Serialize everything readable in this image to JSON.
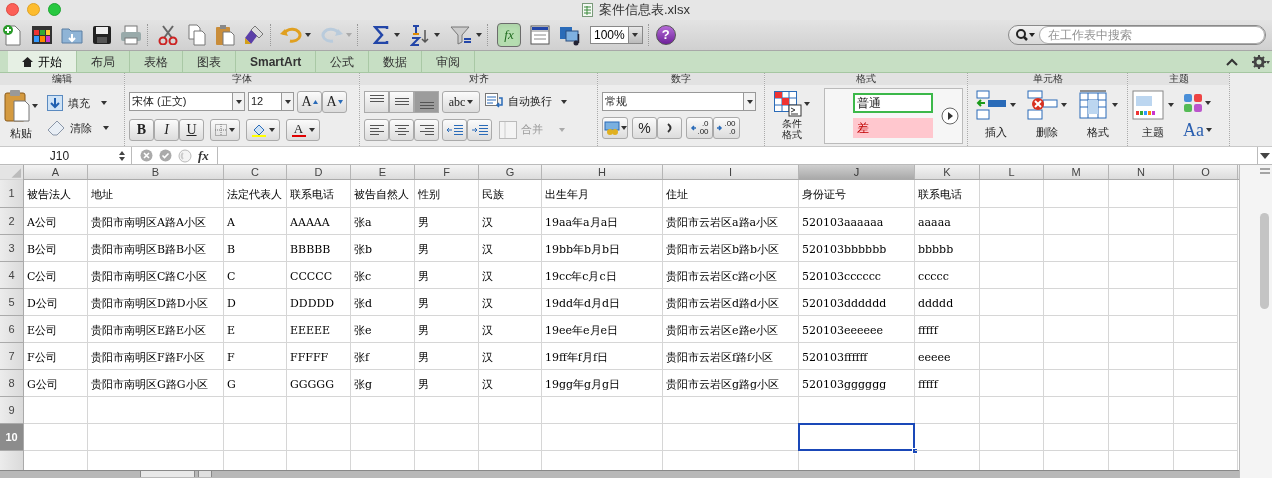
{
  "window": {
    "title": "案件信息表.xlsx"
  },
  "toolbar": {
    "zoom": "100%",
    "formula_builder": {
      "label": "fx",
      "selected": true
    },
    "help": "?",
    "search": {
      "placeholder": "在工作表中搜索"
    }
  },
  "tabs": [
    {
      "label": "开始",
      "selected": true
    },
    {
      "label": "布局",
      "selected": false
    },
    {
      "label": "表格",
      "selected": false
    },
    {
      "label": "图表",
      "selected": false
    },
    {
      "label": "SmartArt",
      "selected": false
    },
    {
      "label": "公式",
      "selected": false
    },
    {
      "label": "数据",
      "selected": false
    },
    {
      "label": "审阅",
      "selected": false
    }
  ],
  "ribbon": {
    "edit": {
      "title": "编辑",
      "paste": "粘贴",
      "fill": "填充",
      "clear": "清除"
    },
    "font": {
      "title": "字体",
      "name": "宋体 (正文)",
      "size": "12",
      "grow": "A",
      "shrink": "A",
      "bold": "B",
      "italic": "I",
      "underline": "U",
      "font_color": "A"
    },
    "align": {
      "title": "对齐",
      "vertical_align": [
        {
          "selected": false
        },
        {
          "selected": false
        },
        {
          "selected": true
        }
      ],
      "orientation": "abc",
      "wrap": "自动换行",
      "merge": "合并",
      "merge_disabled": true
    },
    "number": {
      "title": "数字",
      "format": "常规",
      "percent": "%",
      "decimals": [
        {
          "top": ".0",
          "bottom": ".00"
        },
        {
          "top": ".00",
          "bottom": ".0"
        }
      ]
    },
    "format": {
      "title": "格式",
      "conditional": "条件格式",
      "styles": [
        {
          "label": "普通",
          "kind": "normal"
        },
        {
          "label": "差",
          "kind": "bad"
        }
      ]
    },
    "cells": {
      "title": "单元格",
      "insert": "插入",
      "delete": "删除",
      "format": "格式"
    },
    "themes": {
      "title": "主题",
      "themes": "主题",
      "fonts": "Aa"
    }
  },
  "formula_bar": {
    "name_box": "J10",
    "fx": "fx"
  },
  "sheet": {
    "columns": [
      {
        "label": "A",
        "selected": false
      },
      {
        "label": "B",
        "selected": false
      },
      {
        "label": "C",
        "selected": false
      },
      {
        "label": "D",
        "selected": false
      },
      {
        "label": "E",
        "selected": false
      },
      {
        "label": "F",
        "selected": false
      },
      {
        "label": "G",
        "selected": false
      },
      {
        "label": "H",
        "selected": false
      },
      {
        "label": "I",
        "selected": false
      },
      {
        "label": "J",
        "selected": true
      },
      {
        "label": "K",
        "selected": false
      },
      {
        "label": "L",
        "selected": false
      },
      {
        "label": "M",
        "selected": false
      },
      {
        "label": "N",
        "selected": false
      },
      {
        "label": "O",
        "selected": false
      }
    ],
    "rows": [
      {
        "label": "1",
        "selected": false,
        "cells": [
          "被告法人",
          "地址",
          "法定代表人",
          "联系电话",
          "被告自然人",
          "性别",
          "民族",
          "出生年月",
          "住址",
          "身份证号",
          "联系电话"
        ]
      },
      {
        "label": "2",
        "selected": false,
        "cells": [
          "A公司",
          "贵阳市南明区A路A小区",
          "A",
          "AAAAA",
          "张a",
          "男",
          "汉",
          "19aa年a月a日",
          "贵阳市云岩区a路a小区",
          "520103aaaaaa",
          "aaaaa"
        ]
      },
      {
        "label": "3",
        "selected": false,
        "cells": [
          "B公司",
          "贵阳市南明区B路B小区",
          "B",
          "BBBBB",
          "张b",
          "男",
          "汉",
          "19bb年b月b日",
          "贵阳市云岩区b路b小区",
          "520103bbbbbb",
          "bbbbb"
        ]
      },
      {
        "label": "4",
        "selected": false,
        "cells": [
          "C公司",
          "贵阳市南明区C路C小区",
          "C",
          "CCCCC",
          "张c",
          "男",
          "汉",
          "19cc年c月c日",
          "贵阳市云岩区c路c小区",
          "520103cccccc",
          "ccccc"
        ]
      },
      {
        "label": "5",
        "selected": false,
        "cells": [
          "D公司",
          "贵阳市南明区D路D小区",
          "D",
          "DDDDD",
          "张d",
          "男",
          "汉",
          "19dd年d月d日",
          "贵阳市云岩区d路d小区",
          "520103dddddd",
          "ddddd"
        ]
      },
      {
        "label": "6",
        "selected": false,
        "cells": [
          "E公司",
          "贵阳市南明区E路E小区",
          "E",
          "EEEEE",
          "张e",
          "男",
          "汉",
          "19ee年e月e日",
          "贵阳市云岩区e路e小区",
          "520103eeeeee",
          "fffff"
        ]
      },
      {
        "label": "7",
        "selected": false,
        "cells": [
          "F公司",
          "贵阳市南明区F路F小区",
          "F",
          "FFFFF",
          "张f",
          "男",
          "汉",
          "19ff年f月f日",
          "贵阳市云岩区f路f小区",
          "520103ffffff",
          "eeeee"
        ]
      },
      {
        "label": "8",
        "selected": false,
        "cells": [
          "G公司",
          "贵阳市南明区G路G小区",
          "G",
          "GGGGG",
          "张g",
          "男",
          "汉",
          "19gg年g月g日",
          "贵阳市云岩区g路g小区",
          "520103gggggg",
          "fffff"
        ]
      },
      {
        "label": "9",
        "selected": false
      },
      {
        "label": "10",
        "selected": true
      }
    ]
  }
}
